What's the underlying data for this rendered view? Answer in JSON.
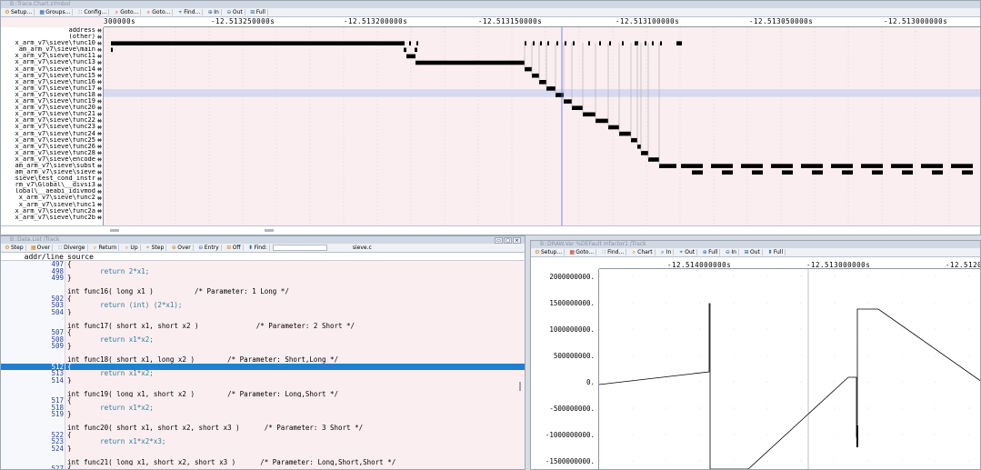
{
  "trace": {
    "title": "B::Trace.Chart.sYmbol",
    "toolbar": [
      "Setup...",
      "Groups...",
      "Config...",
      "Goto...",
      "Goto...",
      "Find...",
      "In",
      "Out",
      "Full"
    ],
    "axis_ticks": [
      "300000s",
      "-12.513250000s",
      "-12.513200000s",
      "-12.513150000s",
      "-12.513100000s",
      "-12.513050000s",
      "-12.513000000s"
    ],
    "rows": [
      {
        "label": "address",
        "dim": false
      },
      {
        "label": "(other)",
        "dim": false
      },
      {
        "label": "x_arm_v7\\sieve\\func10",
        "dim": false
      },
      {
        "label": "am_arm_v7\\sieve\\main",
        "dim": false
      },
      {
        "label": "x_arm_v7\\sieve\\func11",
        "dim": false
      },
      {
        "label": "x_arm_v7\\sieve\\func13",
        "dim": false
      },
      {
        "label": "x_arm_v7\\sieve\\func14",
        "dim": false
      },
      {
        "label": "x_arm_v7\\sieve\\func15",
        "dim": false
      },
      {
        "label": "x_arm_v7\\sieve\\func16",
        "dim": false
      },
      {
        "label": "x_arm_v7\\sieve\\func17",
        "dim": false
      },
      {
        "label": "x_arm_v7\\sieve\\func18",
        "dim": false
      },
      {
        "label": "x_arm_v7\\sieve\\func19",
        "dim": false
      },
      {
        "label": "x_arm_v7\\sieve\\func20",
        "dim": false
      },
      {
        "label": "x_arm_v7\\sieve\\func21",
        "dim": false
      },
      {
        "label": "x_arm_v7\\sieve\\func22",
        "dim": false
      },
      {
        "label": "x_arm_v7\\sieve\\func23",
        "dim": false
      },
      {
        "label": "x_arm_v7\\sieve\\func24",
        "dim": false
      },
      {
        "label": "x_arm_v7\\sieve\\func25",
        "dim": false
      },
      {
        "label": "x_arm_v7\\sieve\\func26",
        "dim": false
      },
      {
        "label": "x_arm_v7\\sieve\\func28",
        "dim": false
      },
      {
        "label": "x_arm_v7\\sieve\\encode",
        "dim": false
      },
      {
        "label": "am_arm_v7\\sieve\\subst",
        "dim": false
      },
      {
        "label": "am_arm_v7\\sieve\\sieve",
        "dim": false
      },
      {
        "label": "sieve\\test_cond_instr",
        "dim": false
      },
      {
        "label": "rm_v7\\Global\\__divsi3",
        "dim": false
      },
      {
        "label": "lobal\\__aeabi_idivmod",
        "dim": false
      },
      {
        "label": "x_arm_v7\\sieve\\func2",
        "dim": false
      },
      {
        "label": "x_arm_v7\\sieve\\func1",
        "dim": false
      },
      {
        "label": "x_arm_v7\\sieve\\func2a",
        "dim": false
      },
      {
        "label": "x_arm_v7\\sieve\\func2b",
        "dim": false
      }
    ]
  },
  "source": {
    "title": "B::Data.List /Track",
    "toolbar": [
      "Step",
      "Over",
      "Diverge",
      "Return",
      "Up",
      "Step",
      "Over",
      "Entry",
      "Off",
      "Find:"
    ],
    "file": "sieve.c",
    "columns": [
      "addr/line",
      "source"
    ],
    "lines": [
      {
        "ln": "497",
        "text": "{"
      },
      {
        "ln": "498",
        "text": "        return 2*x1;"
      },
      {
        "ln": "499",
        "text": "}"
      },
      {
        "ln": "",
        "text": ""
      },
      {
        "ln": "",
        "text": "int func16( long x1 )          /* Parameter: 1 Long */"
      },
      {
        "ln": "502",
        "text": "{"
      },
      {
        "ln": "503",
        "text": "        return (int) (2*x1);"
      },
      {
        "ln": "504",
        "text": "}"
      },
      {
        "ln": "",
        "text": ""
      },
      {
        "ln": "",
        "text": "int func17( short x1, short x2 )              /* Parameter: 2 Short */"
      },
      {
        "ln": "507",
        "text": "{"
      },
      {
        "ln": "508",
        "text": "        return x1*x2;"
      },
      {
        "ln": "509",
        "text": "}"
      },
      {
        "ln": "",
        "text": ""
      },
      {
        "ln": "",
        "text": "int func18( short x1, long x2 )        /* Parameter: Short,Long */"
      },
      {
        "ln": "512",
        "text": "{",
        "selected": true
      },
      {
        "ln": "513",
        "text": "        return x1*x2;"
      },
      {
        "ln": "514",
        "text": "}"
      },
      {
        "ln": "",
        "text": ""
      },
      {
        "ln": "",
        "text": "int func19( long x1, short x2 )        /* Parameter: Long,Short */"
      },
      {
        "ln": "517",
        "text": "{"
      },
      {
        "ln": "518",
        "text": "        return x1*x2;"
      },
      {
        "ln": "519",
        "text": "}"
      },
      {
        "ln": "",
        "text": ""
      },
      {
        "ln": "",
        "text": "int func20( short x1, short x2, short x3 )      /* Parameter: 3 Short */"
      },
      {
        "ln": "522",
        "text": "{"
      },
      {
        "ln": "523",
        "text": "        return x1*x2*x3;"
      },
      {
        "ln": "524",
        "text": "}"
      },
      {
        "ln": "",
        "text": ""
      },
      {
        "ln": "",
        "text": "int func21( long x1, short x2, short x3 )      /* Parameter: Long,Short,Short */"
      },
      {
        "ln": "527",
        "text": "{"
      }
    ]
  },
  "chart": {
    "title": "B::DRAW.Var %DEFault mfactor1 /Track",
    "toolbar": [
      "Setup...",
      "Goto...",
      "Find...",
      "Chart",
      "In",
      "Out",
      "Full",
      "In",
      "Out",
      "Full"
    ],
    "axis_ticks": [
      "-12.514000000s",
      "-12.513000000s",
      "-12.51200"
    ],
    "y_ticks": [
      "2000000000.",
      "1500000000.",
      "1000000000.",
      "500000000.",
      "0.",
      "-500000000.",
      "-1000000000.",
      "-1500000000."
    ]
  }
}
